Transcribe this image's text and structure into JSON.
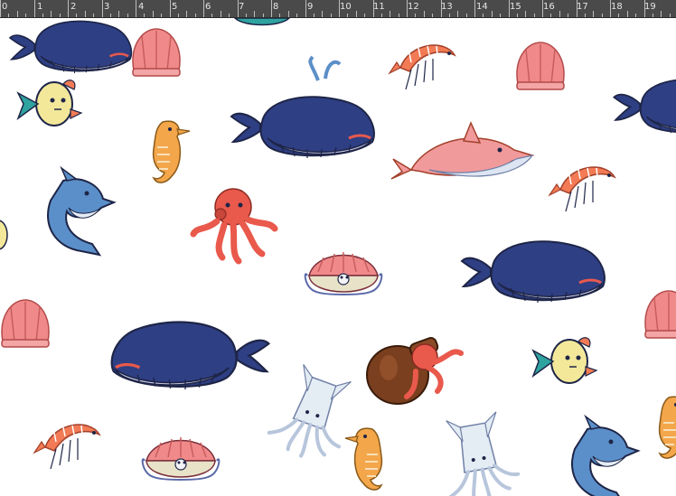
{
  "ruler": {
    "labels": [
      "0",
      "1",
      "2",
      "3",
      "4",
      "5",
      "6",
      "7",
      "8",
      "9",
      "10",
      "11",
      "12",
      "13",
      "14",
      "15",
      "16",
      "17",
      "18",
      "19"
    ]
  },
  "canvas": {
    "background": "#ffffff",
    "pattern": "sea creatures",
    "creatures": [
      "whale",
      "scallop-shell",
      "seahorse",
      "yellow-fish",
      "shrimp",
      "whale",
      "scallop-shell",
      "whale",
      "yellow-fish",
      "seahorse",
      "pink-dolphin",
      "shrimp",
      "blue-dolphin",
      "octopus",
      "clam-with-pearl",
      "whale",
      "scallop-shell",
      "whale",
      "octopus-in-pot",
      "yellow-fish",
      "scallop-shell",
      "squid",
      "shrimp",
      "clam-with-pearl",
      "seahorse",
      "squid",
      "blue-dolphin",
      "seahorse"
    ]
  },
  "colors": {
    "whale_blue": "#2e3f84",
    "whale_belly": "#c9cbe8",
    "shell_pink": "#f08a8a",
    "shrimp_orange": "#f27b55",
    "fish_yellow": "#f3e89a",
    "fish_teal": "#2fa3a0",
    "dolphin_blue": "#5b8fc9",
    "dolphin_pink": "#f19a9c",
    "octopus_red": "#e9594c",
    "seahorse_orange": "#f3a64a",
    "squid_pale": "#e4ecf4",
    "pot_brown": "#7a3f1f",
    "outline": "#1e2547"
  }
}
